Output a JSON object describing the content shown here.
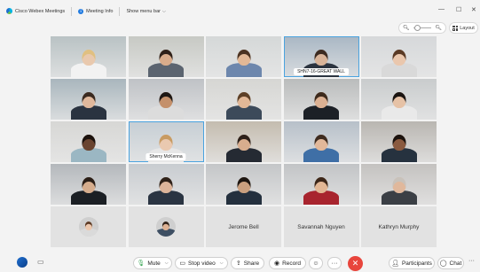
{
  "titlebar": {
    "app_name": "Cisco Webex Meetings",
    "meeting_info": "Meeting Info",
    "show_menu_bar": "Show menu bar",
    "minimize": "—",
    "maximize": "☐",
    "close": "✕"
  },
  "view": {
    "zoom_level": 0.25,
    "layout_label": "Layout"
  },
  "tiles": [
    {
      "label": "",
      "bg": "#b9c2c4",
      "skin": "#e9c9ae",
      "hair": "#e0c081",
      "shirt": "#f2f2f2"
    },
    {
      "label": "",
      "bg": "#c7c9c4",
      "skin": "#d9ac8b",
      "hair": "#2f2119",
      "shirt": "#5b6470"
    },
    {
      "label": "",
      "bg": "#d5d8d8",
      "skin": "#e2b896",
      "hair": "#4b3322",
      "shirt": "#6d87ad"
    },
    {
      "label": "SHN7-16-GREAT WALL",
      "bg": "#a9b7c4",
      "skin": "#d9b499",
      "hair": "#3c2b21",
      "shirt": "#2c3440",
      "active": true
    },
    {
      "label": "",
      "bg": "#d6d8da",
      "skin": "#eac7ad",
      "hair": "#5a3a25",
      "shirt": "#d9d9d9"
    },
    {
      "label": "",
      "bg": "#a9b6bd",
      "skin": "#e0b89c",
      "hair": "#3a2a20",
      "shirt": "#2a3340"
    },
    {
      "label": "",
      "bg": "#bfc2c6",
      "skin": "#c4906b",
      "hair": "#1d1714",
      "shirt": "#dcdcdc"
    },
    {
      "label": "",
      "bg": "#d6d6d3",
      "skin": "#e2b897",
      "hair": "#5d4027",
      "shirt": "#3c4a5a"
    },
    {
      "label": "",
      "bg": "#babcbc",
      "skin": "#dcb193",
      "hair": "#3d2a1c",
      "shirt": "#1c2026"
    },
    {
      "label": "",
      "bg": "#c9cccd",
      "skin": "#e6c2a6",
      "hair": "#1a1411",
      "shirt": "#e9e9e9"
    },
    {
      "label": "",
      "bg": "#d7d7d5",
      "skin": "#6a4430",
      "hair": "#1c120d",
      "shirt": "#9bb7c3"
    },
    {
      "label": "Sherry McKenna",
      "bg": "#c6ced4",
      "skin": "#eac9b0",
      "hair": "#c89b62",
      "shirt": "#e7e7e7",
      "active": true
    },
    {
      "label": "",
      "bg": "#c4bcaf",
      "skin": "#d8ad8e",
      "hair": "#2d211a",
      "shirt": "#252a33"
    },
    {
      "label": "",
      "bg": "#b7c0c9",
      "skin": "#e2b89a",
      "hair": "#3e2c20",
      "shirt": "#3f6fa6"
    },
    {
      "label": "",
      "bg": "#b9b6b1",
      "skin": "#8a5a3f",
      "hair": "#1c130e",
      "shirt": "#26323f"
    },
    {
      "label": "",
      "bg": "#b4b8bc",
      "skin": "#d6ad8d",
      "hair": "#2a1e17",
      "shirt": "#1b1f24"
    },
    {
      "label": "",
      "bg": "#c8ccd0",
      "skin": "#dcb49a",
      "hair": "#2e2119",
      "shirt": "#2a3442"
    },
    {
      "label": "",
      "bg": "#c4c6c8",
      "skin": "#caa07f",
      "hair": "#1d1611",
      "shirt": "#24303e"
    },
    {
      "label": "",
      "bg": "#c2c4c6",
      "skin": "#e2b795",
      "hair": "#3b2619",
      "shirt": "#a8242e"
    },
    {
      "label": "",
      "bg": "#c4c2c0",
      "skin": "#e0b89c",
      "hair": "#c8c2bb",
      "shirt": "#3b3f45"
    }
  ],
  "bottom_row": [
    {
      "type": "avatar",
      "name": "",
      "skin": "#ecc8ae",
      "hair": "#5b3924",
      "shirt": "#dadada"
    },
    {
      "type": "avatar",
      "name": "",
      "skin": "#ddb193",
      "hair": "#2e2119",
      "shirt": "#3e4f63"
    },
    {
      "type": "name",
      "name": "Jerome Bell"
    },
    {
      "type": "name",
      "name": "Savannah Nguyen"
    },
    {
      "type": "name",
      "name": "Kathryn Murphy"
    }
  ],
  "controls": {
    "mute": "Mute",
    "stop_video": "Stop video",
    "share": "Share",
    "record": "Record",
    "participants": "Participants",
    "chat": "Chat"
  },
  "colors": {
    "accent": "#4aa3df",
    "leave_red": "#e8453c",
    "mic_green": "#3aa655"
  }
}
